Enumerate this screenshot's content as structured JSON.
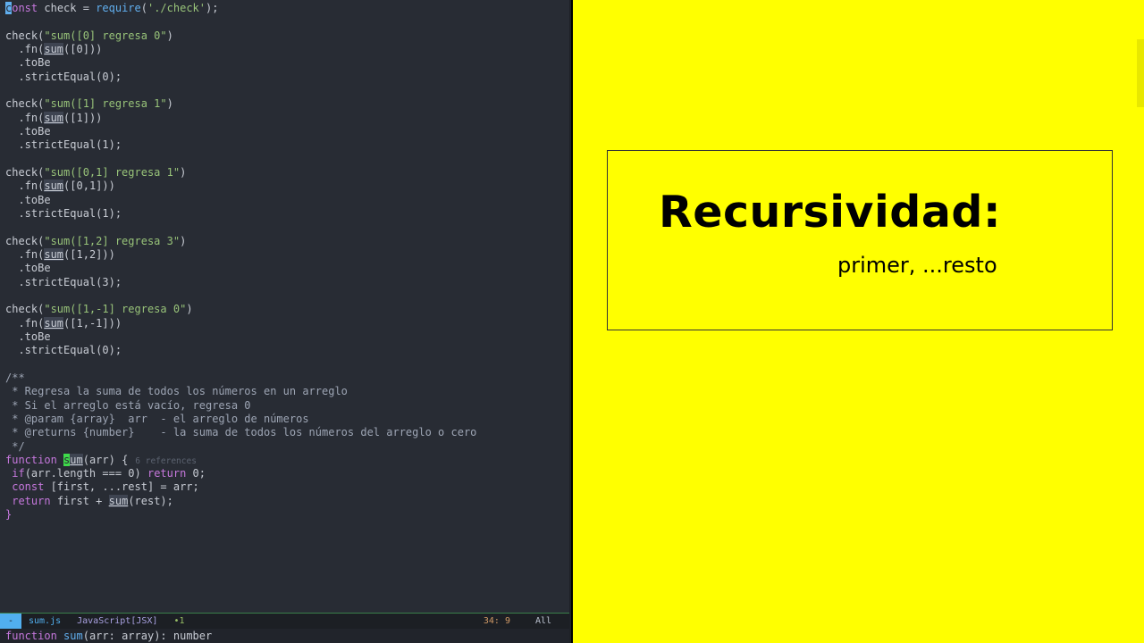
{
  "editor": {
    "code_lines": [
      [
        {
          "t": "c",
          "k": "cursor0"
        },
        {
          "t": "onst",
          "k": "kw"
        },
        {
          "t": " check = ",
          "k": ""
        },
        {
          "t": "require",
          "k": "fn-name"
        },
        {
          "t": "(",
          "k": ""
        },
        {
          "t": "'./check'",
          "k": "str"
        },
        {
          "t": ");",
          "k": ""
        }
      ],
      [],
      [
        {
          "t": "check(",
          "k": ""
        },
        {
          "t": "\"sum([0] regresa 0\"",
          "k": "str"
        },
        {
          "t": ")",
          "k": ""
        }
      ],
      [
        {
          "t": "  .fn(",
          "k": ""
        },
        {
          "t": "sum",
          "k": "hl"
        },
        {
          "t": "([0]))",
          "k": ""
        }
      ],
      [
        {
          "t": "  .toBe",
          "k": ""
        }
      ],
      [
        {
          "t": "  .strictEqual(0);",
          "k": ""
        }
      ],
      [],
      [
        {
          "t": "check(",
          "k": ""
        },
        {
          "t": "\"sum([1] regresa 1\"",
          "k": "str"
        },
        {
          "t": ")",
          "k": ""
        }
      ],
      [
        {
          "t": "  .fn(",
          "k": ""
        },
        {
          "t": "sum",
          "k": "hl"
        },
        {
          "t": "([1]))",
          "k": ""
        }
      ],
      [
        {
          "t": "  .toBe",
          "k": ""
        }
      ],
      [
        {
          "t": "  .strictEqual(1);",
          "k": ""
        }
      ],
      [],
      [
        {
          "t": "check(",
          "k": ""
        },
        {
          "t": "\"sum([0,1] regresa 1\"",
          "k": "str"
        },
        {
          "t": ")",
          "k": ""
        }
      ],
      [
        {
          "t": "  .fn(",
          "k": ""
        },
        {
          "t": "sum",
          "k": "hl"
        },
        {
          "t": "([0,1]))",
          "k": ""
        }
      ],
      [
        {
          "t": "  .toBe",
          "k": ""
        }
      ],
      [
        {
          "t": "  .strictEqual(1);",
          "k": ""
        }
      ],
      [],
      [
        {
          "t": "check(",
          "k": ""
        },
        {
          "t": "\"sum([1,2] regresa 3\"",
          "k": "str"
        },
        {
          "t": ")",
          "k": ""
        }
      ],
      [
        {
          "t": "  .fn(",
          "k": ""
        },
        {
          "t": "sum",
          "k": "hl"
        },
        {
          "t": "([1,2]))",
          "k": ""
        }
      ],
      [
        {
          "t": "  .toBe",
          "k": ""
        }
      ],
      [
        {
          "t": "  .strictEqual(3);",
          "k": ""
        }
      ],
      [],
      [
        {
          "t": "check(",
          "k": ""
        },
        {
          "t": "\"sum([1,-1] regresa 0\"",
          "k": "str"
        },
        {
          "t": ")",
          "k": ""
        }
      ],
      [
        {
          "t": "  .fn(",
          "k": ""
        },
        {
          "t": "sum",
          "k": "hl"
        },
        {
          "t": "([1,-1]))",
          "k": ""
        }
      ],
      [
        {
          "t": "  .toBe",
          "k": ""
        }
      ],
      [
        {
          "t": "  .strictEqual(0);",
          "k": ""
        }
      ],
      [],
      [
        {
          "t": "/**",
          "k": "cm"
        }
      ],
      [
        {
          "t": " * Regresa la suma de todos los números en un arreglo",
          "k": "cm"
        }
      ],
      [
        {
          "t": " * Si el arreglo está vacío, regresa 0",
          "k": "cm"
        }
      ],
      [
        {
          "t": " * @param {array}  arr  - el arreglo de números",
          "k": "cm"
        }
      ],
      [
        {
          "t": " * @returns {number}    - la suma de todos los números del arreglo o cero",
          "k": "cm"
        }
      ],
      [
        {
          "t": " */",
          "k": "cm"
        }
      ],
      [
        {
          "t": "function",
          "k": "kw"
        },
        {
          "t": " ",
          "k": ""
        },
        {
          "t": "s",
          "k": "cursor"
        },
        {
          "t": "um",
          "k": "hl"
        },
        {
          "t": "(arr) {",
          "k": ""
        },
        {
          "t": "6 references",
          "k": "ref"
        }
      ],
      [
        {
          "t": " ",
          "k": ""
        },
        {
          "t": "if",
          "k": "kw"
        },
        {
          "t": "(arr.length === 0) ",
          "k": ""
        },
        {
          "t": "return",
          "k": "kw"
        },
        {
          "t": " 0;",
          "k": ""
        }
      ],
      [
        {
          "t": " ",
          "k": ""
        },
        {
          "t": "const",
          "k": "kw"
        },
        {
          "t": " [first, ...rest] = arr;",
          "k": ""
        }
      ],
      [
        {
          "t": " ",
          "k": ""
        },
        {
          "t": "return",
          "k": "kw"
        },
        {
          "t": " first + ",
          "k": ""
        },
        {
          "t": "sum",
          "k": "hl"
        },
        {
          "t": "(rest);",
          "k": ""
        }
      ],
      [
        {
          "t": "}",
          "k": "kw"
        }
      ]
    ]
  },
  "modeline": {
    "evil_state": "-",
    "filename": "sum.js",
    "major_mode": "JavaScript[JSX]",
    "indicator": "•1",
    "position": "34: 9",
    "percent": "All"
  },
  "echo_area": {
    "kw": "function",
    "fn": "sum",
    "rest": "(arr: array): number"
  },
  "slide": {
    "title": "Recursividad:",
    "subtitle": "primer, ...resto"
  },
  "colors": {
    "editor_bg": "#282c34",
    "slide_bg": "#ffff00",
    "keyword": "#c678dd",
    "string": "#98c379",
    "cursor": "#3edb4a"
  }
}
